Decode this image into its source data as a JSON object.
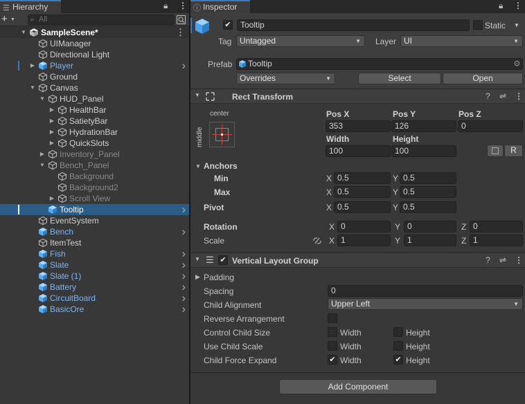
{
  "hierarchy": {
    "tab_label": "Hierarchy",
    "search_placeholder": "All",
    "add_label": "+",
    "rows": [
      {
        "label": "SampleScene*",
        "indent": 0,
        "fold": "open",
        "icon": "unity-scene-icon",
        "color": "white",
        "bold": true,
        "scene": true,
        "menu": "⋮"
      },
      {
        "label": "UIManager",
        "indent": 1,
        "fold": "",
        "icon": "gameobject-icon",
        "color": "norm"
      },
      {
        "label": "Directional Light",
        "indent": 1,
        "fold": "",
        "icon": "gameobject-icon",
        "color": "norm"
      },
      {
        "label": "Player",
        "indent": 1,
        "fold": "closed",
        "icon": "prefab-icon",
        "color": "blue",
        "chevron": true,
        "marker": true
      },
      {
        "label": "Ground",
        "indent": 1,
        "fold": "",
        "icon": "gameobject-icon",
        "color": "norm"
      },
      {
        "label": "Canvas",
        "indent": 1,
        "fold": "open",
        "icon": "gameobject-icon",
        "color": "norm"
      },
      {
        "label": "HUD_Panel",
        "indent": 2,
        "fold": "open",
        "icon": "gameobject-icon",
        "color": "norm"
      },
      {
        "label": "HealthBar",
        "indent": 3,
        "fold": "closed",
        "icon": "gameobject-icon",
        "color": "norm"
      },
      {
        "label": "SatietyBar",
        "indent": 3,
        "fold": "closed",
        "icon": "gameobject-icon",
        "color": "norm"
      },
      {
        "label": "HydrationBar",
        "indent": 3,
        "fold": "closed",
        "icon": "gameobject-icon",
        "color": "norm"
      },
      {
        "label": "QuickSlots",
        "indent": 3,
        "fold": "closed",
        "icon": "gameobject-icon",
        "color": "norm"
      },
      {
        "label": "Inventory_Panel",
        "indent": 2,
        "fold": "closed",
        "icon": "gameobject-icon",
        "color": "dim"
      },
      {
        "label": "Bench_Panel",
        "indent": 2,
        "fold": "open",
        "icon": "gameobject-icon",
        "color": "dim"
      },
      {
        "label": "Background",
        "indent": 3,
        "fold": "",
        "icon": "gameobject-icon",
        "color": "dim"
      },
      {
        "label": "Background2",
        "indent": 3,
        "fold": "",
        "icon": "gameobject-icon",
        "color": "dim"
      },
      {
        "label": "Scroll View",
        "indent": 3,
        "fold": "closed",
        "icon": "gameobject-icon",
        "color": "dim"
      },
      {
        "label": "Tooltip",
        "indent": 2,
        "fold": "",
        "icon": "prefab-icon",
        "color": "white",
        "selected": true,
        "chevron": true
      },
      {
        "label": "EventSystem",
        "indent": 1,
        "fold": "",
        "icon": "gameobject-icon",
        "color": "norm"
      },
      {
        "label": "Bench",
        "indent": 1,
        "fold": "",
        "icon": "prefab-icon",
        "color": "blue",
        "chevron": true
      },
      {
        "label": "ItemTest",
        "indent": 1,
        "fold": "",
        "icon": "gameobject-icon",
        "color": "norm"
      },
      {
        "label": "Fish",
        "indent": 1,
        "fold": "",
        "icon": "prefab-icon",
        "color": "blue",
        "chevron": true
      },
      {
        "label": "Slate",
        "indent": 1,
        "fold": "",
        "icon": "prefab-icon",
        "color": "blue",
        "chevron": true
      },
      {
        "label": "Slate (1)",
        "indent": 1,
        "fold": "",
        "icon": "prefab-icon",
        "color": "blue",
        "chevron": true
      },
      {
        "label": "Battery",
        "indent": 1,
        "fold": "",
        "icon": "prefab-icon",
        "color": "blue",
        "chevron": true
      },
      {
        "label": "CircuitBoard",
        "indent": 1,
        "fold": "",
        "icon": "prefab-icon",
        "color": "blue",
        "chevron": true
      },
      {
        "label": "BasicOre",
        "indent": 1,
        "fold": "",
        "icon": "prefab-icon",
        "color": "blue",
        "chevron": true
      }
    ]
  },
  "inspector": {
    "tab_label": "Inspector",
    "object_name": "Tooltip",
    "active_checked": true,
    "static_label": "Static",
    "tag_label": "Tag",
    "tag_value": "Untagged",
    "layer_label": "Layer",
    "layer_value": "UI",
    "prefab_label": "Prefab",
    "prefab_value": "Tooltip",
    "overrides_label": "Overrides",
    "select_label": "Select",
    "open_label": "Open",
    "rect_transform": {
      "title": "Rect Transform",
      "anchor_preset_top": "center",
      "anchor_preset_side": "middle",
      "pos_x_label": "Pos X",
      "pos_x": "353",
      "pos_y_label": "Pos Y",
      "pos_y": "126",
      "pos_z_label": "Pos Z",
      "pos_z": "0",
      "width_label": "Width",
      "width": "100",
      "height_label": "Height",
      "height": "100",
      "raw_label": "R",
      "anchors_label": "Anchors",
      "min_label": "Min",
      "min_x": "0.5",
      "min_y": "0.5",
      "max_label": "Max",
      "max_x": "0.5",
      "max_y": "0.5",
      "pivot_label": "Pivot",
      "pivot_x": "0.5",
      "pivot_y": "0.5",
      "rotation_label": "Rotation",
      "rot_x": "0",
      "rot_y": "0",
      "rot_z": "0",
      "scale_label": "Scale",
      "scale_x": "1",
      "scale_y": "1",
      "scale_z": "1",
      "x": "X",
      "y": "Y",
      "z": "Z"
    },
    "vlg": {
      "title": "Vertical Layout Group",
      "enabled": true,
      "padding_label": "Padding",
      "spacing_label": "Spacing",
      "spacing": "0",
      "child_alignment_label": "Child Alignment",
      "child_alignment": "Upper Left",
      "reverse_label": "Reverse Arrangement",
      "control_size_label": "Control Child Size",
      "use_scale_label": "Use Child Scale",
      "force_expand_label": "Child Force Expand",
      "width_label": "Width",
      "height_label": "Height",
      "control_w": false,
      "control_h": false,
      "scale_w": false,
      "scale_h": false,
      "expand_w": true,
      "expand_h": true
    },
    "add_component_label": "Add Component"
  }
}
